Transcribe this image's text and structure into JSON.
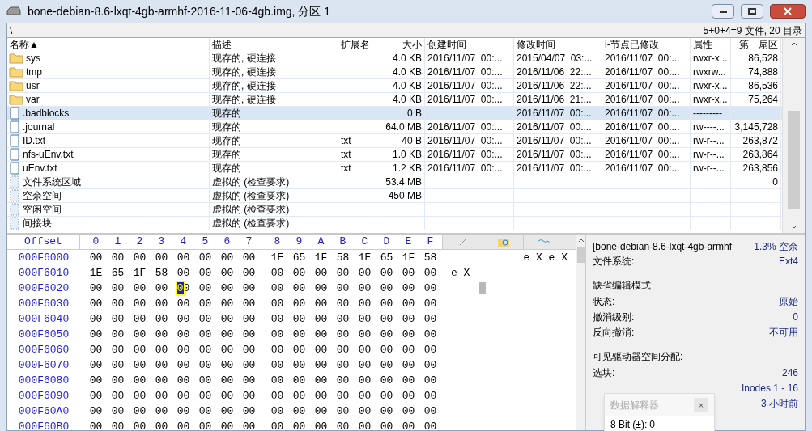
{
  "window": {
    "title": "bone-debian-8.6-lxqt-4gb-armhf-2016-11-06-4gb.img, 分区 1"
  },
  "path_bar": {
    "path": "\\",
    "summary": "5+0+4=9 文件, 20 目录"
  },
  "file_table": {
    "columns": [
      {
        "label": "名称▲"
      },
      {
        "label": "描述"
      },
      {
        "label": "扩展名"
      },
      {
        "label": "大小"
      },
      {
        "label": "创建时间"
      },
      {
        "label": "修改时间"
      },
      {
        "label": "i-节点已修改"
      },
      {
        "label": "属性"
      },
      {
        "label": "第一扇区"
      }
    ],
    "rows": [
      {
        "kind": "folder",
        "selected": false,
        "cells": [
          "sys",
          "现存的, 硬连接",
          "",
          "4.0 KB",
          "2016/11/07  00:...",
          "2015/04/07  03:...",
          "2016/11/07  00:...",
          "rwxr-x...",
          "86,528"
        ]
      },
      {
        "kind": "folder",
        "selected": false,
        "cells": [
          "tmp",
          "现存的, 硬连接",
          "",
          "4.0 KB",
          "2016/11/07  00:...",
          "2016/11/06  22:...",
          "2016/11/07  00:...",
          "rwxrw...",
          "74,888"
        ]
      },
      {
        "kind": "folder",
        "selected": false,
        "cells": [
          "usr",
          "现存的, 硬连接",
          "",
          "4.0 KB",
          "2016/11/07  00:...",
          "2016/11/06  22:...",
          "2016/11/07  00:...",
          "rwxr-x...",
          "86,536"
        ]
      },
      {
        "kind": "folder",
        "selected": false,
        "cells": [
          "var",
          "现存的, 硬连接",
          "",
          "4.0 KB",
          "2016/11/07  00:...",
          "2016/11/06  21:...",
          "2016/11/07  00:...",
          "rwxr-x...",
          "75,264"
        ]
      },
      {
        "kind": "file",
        "selected": true,
        "cells": [
          ".badblocks",
          "现存的",
          "",
          "0 B",
          "",
          "2016/11/07  00:...",
          "2016/11/07  00:...",
          "---------",
          ""
        ]
      },
      {
        "kind": "file",
        "selected": false,
        "cells": [
          ".journal",
          "现存的",
          "",
          "64.0 MB",
          "2016/11/07  00:...",
          "2016/11/07  00:...",
          "2016/11/07  00:...",
          "rw----...",
          "3,145,728"
        ]
      },
      {
        "kind": "file",
        "selected": false,
        "cells": [
          "ID.txt",
          "现存的",
          "txt",
          "40 B",
          "2016/11/07  00:...",
          "2016/11/07  00:...",
          "2016/11/07  00:...",
          "rw-r--...",
          "263,872"
        ]
      },
      {
        "kind": "file",
        "selected": false,
        "cells": [
          "nfs-uEnv.txt",
          "现存的",
          "txt",
          "1.0 KB",
          "2016/11/07  00:...",
          "2016/11/07  00:...",
          "2016/11/07  00:...",
          "rw-r--...",
          "263,864"
        ]
      },
      {
        "kind": "file",
        "selected": false,
        "cells": [
          "uEnv.txt",
          "现存的",
          "txt",
          "1.2 KB",
          "2016/11/07  00:...",
          "2016/11/07  00:...",
          "2016/11/07  00:...",
          "rw-r--...",
          "263,856"
        ]
      },
      {
        "kind": "virtual",
        "selected": false,
        "cells": [
          "文件系统区域",
          "虚拟的 (检查要求)",
          "",
          "53.4 MB",
          "",
          "",
          "",
          "",
          "0"
        ]
      },
      {
        "kind": "virtual",
        "selected": false,
        "cells": [
          "空余空间",
          "虚拟的 (检查要求)",
          "",
          "450 MB",
          "",
          "",
          "",
          "",
          ""
        ]
      },
      {
        "kind": "virtual",
        "selected": false,
        "cells": [
          "空闲空间",
          "虚拟的 (检查要求)",
          "",
          "",
          "",
          "",
          "",
          "",
          ""
        ]
      },
      {
        "kind": "virtual",
        "selected": false,
        "cells": [
          "间接块",
          "虚拟的 (检查要求)",
          "",
          "",
          "",
          "",
          "",
          "",
          ""
        ]
      }
    ]
  },
  "hex_view": {
    "offset_label": "Offset",
    "column_labels": [
      "0",
      "1",
      "2",
      "3",
      "4",
      "5",
      "6",
      "7",
      "8",
      "9",
      "A",
      "B",
      "C",
      "D",
      "E",
      "F"
    ],
    "rows": [
      {
        "offset": "000F6000",
        "bytes": "00 00 00 00 00 00 00 00 1E 65 1F 58 1E 65 1F 58",
        "text": "e X e X",
        "cursor": false
      },
      {
        "offset": "000F6010",
        "bytes": "1E 65 1F 58 00 00 00 00 00 00 00 00 00 00 00 00",
        "text": "e X",
        "cursor": false
      },
      {
        "offset": "000F6020",
        "bytes": "00 00 00 00 00 00 00 00 00 00 00 00 00 00 00 00",
        "cursor": true
      },
      {
        "offset": "000F6030",
        "bytes": "00 00 00 00 00 00 00 00 00 00 00 00 00 00 00 00",
        "cursor": false
      },
      {
        "offset": "000F6040",
        "bytes": "00 00 00 00 00 00 00 00 00 00 00 00 00 00 00 00",
        "cursor": false
      },
      {
        "offset": "000F6050",
        "bytes": "00 00 00 00 00 00 00 00 00 00 00 00 00 00 00 00",
        "cursor": false
      },
      {
        "offset": "000F6060",
        "bytes": "00 00 00 00 00 00 00 00 00 00 00 00 00 00 00 00",
        "cursor": false
      },
      {
        "offset": "000F6070",
        "bytes": "00 00 00 00 00 00 00 00 00 00 00 00 00 00 00 00",
        "cursor": false
      },
      {
        "offset": "000F6080",
        "bytes": "00 00 00 00 00 00 00 00 00 00 00 00 00 00 00 00",
        "cursor": false
      },
      {
        "offset": "000F6090",
        "bytes": "00 00 00 00 00 00 00 00 00 00 00 00 00 00 00 00",
        "cursor": false
      },
      {
        "offset": "000F60A0",
        "bytes": "00 00 00 00 00 00 00 00 00 00 00 00 00 00 00 00",
        "cursor": false
      },
      {
        "offset": "000F60B0",
        "bytes": "00 00 00 00 00 00 00 00 00 00 00 00 00 00 00 00",
        "cursor": false
      }
    ]
  },
  "info_panel": {
    "header": {
      "name": "[bone-debian-8.6-lxqt-4gb-armhf",
      "free": "1.3% 空余"
    },
    "sections": [
      {
        "rows": [
          {
            "label": "文件系统:",
            "value": "Ext4"
          }
        ]
      },
      {
        "title": "缺省编辑模式",
        "rows": [
          {
            "label": "状态:",
            "value": "原始"
          },
          {
            "label": "撤消级别:",
            "value": "0"
          },
          {
            "label": "反向撤消:",
            "value": "不可用"
          }
        ]
      },
      {
        "title": "可见驱动器空间分配:",
        "rows": [
          {
            "label": "选块:",
            "value": "246"
          },
          {
            "label": "",
            "value": "Inodes 1 - 16"
          },
          {
            "label": "",
            "value": "3 小时前"
          }
        ]
      }
    ]
  },
  "interpreter_popup": {
    "title": "数据解释器",
    "close": "×",
    "label": "8 Bit (±):",
    "value": "0"
  }
}
